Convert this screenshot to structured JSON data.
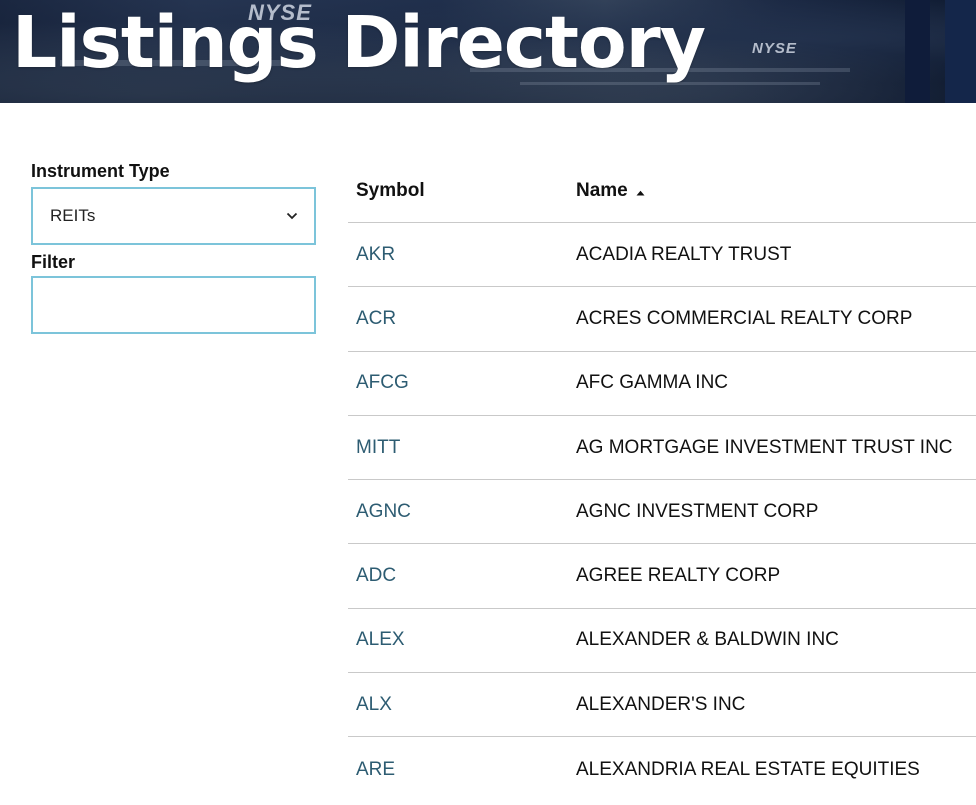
{
  "header": {
    "title": "Listings Directory",
    "banner_signs": [
      "NYSE",
      "NYSE"
    ]
  },
  "filters": {
    "instrument_type_label": "Instrument Type",
    "instrument_type_value": "REITs",
    "filter_label": "Filter",
    "filter_value": ""
  },
  "table": {
    "columns": [
      "Symbol",
      "Name"
    ],
    "sort_column": "Name",
    "sort_direction": "ascending",
    "rows": [
      {
        "symbol": "AKR",
        "name": "ACADIA REALTY TRUST"
      },
      {
        "symbol": "ACR",
        "name": "ACRES COMMERCIAL REALTY CORP"
      },
      {
        "symbol": "AFCG",
        "name": "AFC GAMMA INC"
      },
      {
        "symbol": "MITT",
        "name": "AG MORTGAGE INVESTMENT TRUST INC"
      },
      {
        "symbol": "AGNC",
        "name": "AGNC INVESTMENT CORP"
      },
      {
        "symbol": "ADC",
        "name": "AGREE REALTY CORP"
      },
      {
        "symbol": "ALEX",
        "name": "ALEXANDER & BALDWIN INC"
      },
      {
        "symbol": "ALX",
        "name": "ALEXANDER'S INC"
      },
      {
        "symbol": "ARE",
        "name": "ALEXANDRIA REAL ESTATE EQUITIES"
      }
    ]
  },
  "colors": {
    "symbol_link": "#2d5c72",
    "input_border": "#7cc4da",
    "divider": "#c9c9c9"
  }
}
